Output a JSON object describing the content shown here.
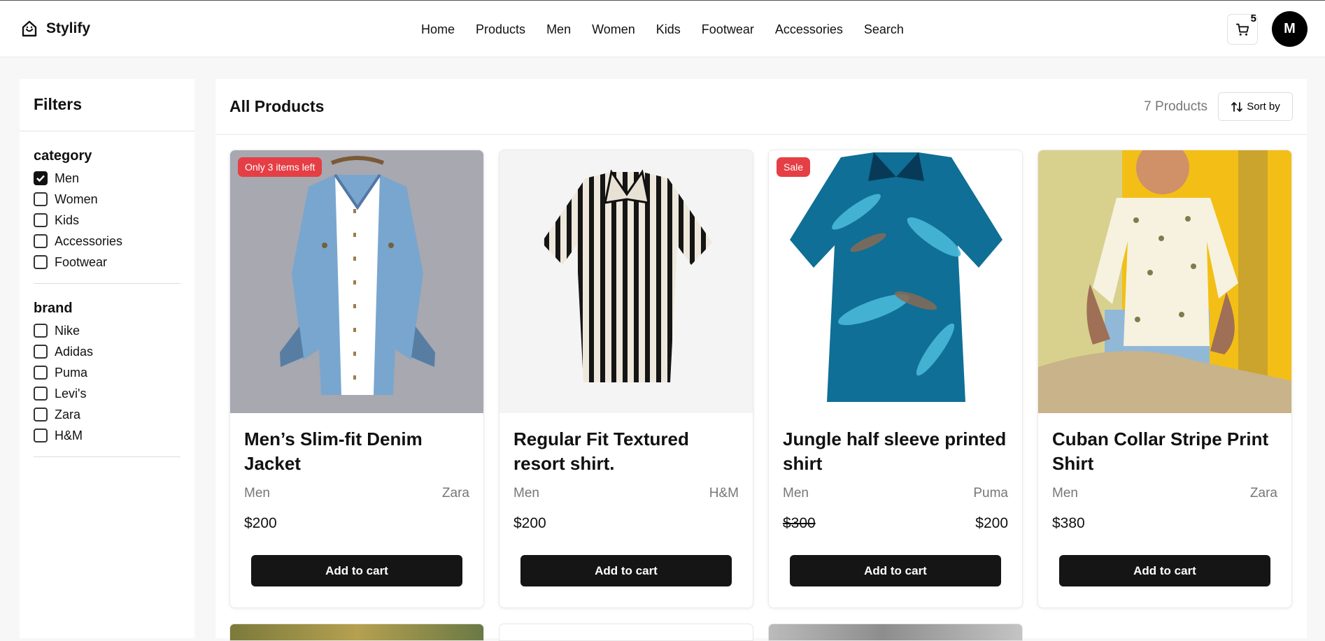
{
  "header": {
    "brand": "Stylify",
    "nav": [
      "Home",
      "Products",
      "Men",
      "Women",
      "Kids",
      "Footwear",
      "Accessories",
      "Search"
    ],
    "cart_count": "5",
    "avatar_initial": "M"
  },
  "filters": {
    "title": "Filters",
    "category": {
      "title": "category",
      "options": [
        "Men",
        "Women",
        "Kids",
        "Accessories",
        "Footwear"
      ],
      "selected": "Men"
    },
    "brand": {
      "title": "brand",
      "options": [
        "Nike",
        "Adidas",
        "Puma",
        "Levi's",
        "Zara",
        "H&M"
      ]
    }
  },
  "main": {
    "title": "All Products",
    "product_count": "7 Products",
    "sort_label": "Sort by",
    "products": [
      {
        "badge": "Only 3 items left",
        "name": "Men’s Slim-fit Denim Jacket",
        "category": "Men",
        "brand": "Zara",
        "price": "$200",
        "button": "Add to cart"
      },
      {
        "badge": "",
        "name": "Regular Fit Textured resort shirt.",
        "category": "Men",
        "brand": "H&M",
        "price": "$200",
        "button": "Add to cart"
      },
      {
        "badge": "Sale",
        "name": "Jungle half sleeve printed shirt",
        "category": "Men",
        "brand": "Puma",
        "old_price": "$300",
        "price": "$200",
        "button": "Add to cart"
      },
      {
        "badge": "",
        "name": "Cuban Collar Stripe Print Shirt",
        "category": "Men",
        "brand": "Zara",
        "price": "$380",
        "button": "Add to cart"
      }
    ]
  },
  "colors": {
    "badge": "#e53e45",
    "button": "#151515",
    "denim": "#79a6cf",
    "jungle": "#0f6f96"
  }
}
